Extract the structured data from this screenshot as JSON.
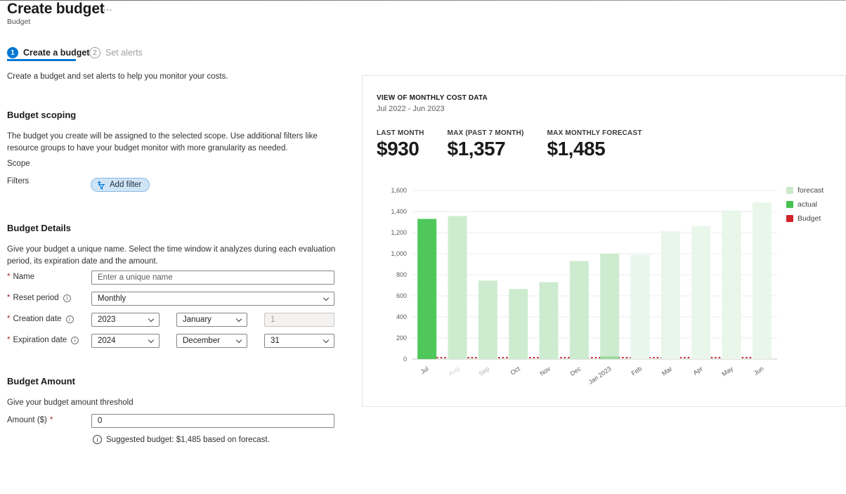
{
  "page": {
    "title": "Create budget",
    "more_label": "…",
    "subtitle": "Budget",
    "description": "Create a budget and set alerts to help you monitor your costs."
  },
  "tabs": [
    {
      "number": "1",
      "label": "Create a budget"
    },
    {
      "number": "2",
      "label": "Set alerts"
    }
  ],
  "scoping": {
    "heading": "Budget scoping",
    "description": "The budget you create will be assigned to the selected scope. Use additional filters like resource groups to have your budget monitor with more granularity as needed.",
    "scope_label": "Scope",
    "filters_label": "Filters",
    "add_filter_label": "Add filter"
  },
  "details": {
    "heading": "Budget Details",
    "description": "Give your budget a unique name. Select the time window it analyzes during each evaluation period, its expiration date and the amount.",
    "name_label": "Name",
    "name_placeholder": "Enter a unique name",
    "reset_period_label": "Reset period",
    "reset_period_value": "Monthly",
    "creation_date_label": "Creation date",
    "creation_year": "2023",
    "creation_month": "January",
    "creation_day": "1",
    "expiration_date_label": "Expiration date",
    "expiration_year": "2024",
    "expiration_month": "December",
    "expiration_day": "31"
  },
  "amount": {
    "heading": "Budget Amount",
    "description": "Give your budget amount threshold",
    "label": "Amount ($)",
    "value": "0",
    "suggestion": "Suggested budget: $1,485 based on forecast."
  },
  "cost_panel": {
    "heading": "VIEW OF MONTHLY COST DATA",
    "date_range": "Jul 2022 - Jun 2023",
    "stats": [
      {
        "label": "LAST MONTH",
        "value": "$930"
      },
      {
        "label": "MAX (PAST 7 MONTH)",
        "value": "$1,357"
      },
      {
        "label": "MAX MONTHLY FORECAST",
        "value": "$1,485"
      }
    ]
  },
  "chart_data": {
    "type": "bar",
    "title": "View of monthly cost data",
    "xlabel": "",
    "ylabel": "",
    "ylim": [
      0,
      1600
    ],
    "ytick_step": 200,
    "grid": "horizontal",
    "legend_position": "top-right",
    "categories": [
      "Jul",
      "Aug",
      "Sep",
      "Oct",
      "Nov",
      "Dec",
      "Jan 2023",
      "Feb",
      "Mar",
      "Apr",
      "May",
      "Jun"
    ],
    "bars": [
      {
        "month": "Jul",
        "value": 1330,
        "kind": "actual"
      },
      {
        "month": "Aug",
        "value": 1357,
        "kind": "forecast",
        "label_color": "#d6d6d6"
      },
      {
        "month": "Sep",
        "value": 745,
        "kind": "forecast",
        "label_color": "#b3b3b3"
      },
      {
        "month": "Oct",
        "value": 665,
        "kind": "forecast"
      },
      {
        "month": "Nov",
        "value": 730,
        "kind": "forecast"
      },
      {
        "month": "Dec",
        "value": 930,
        "kind": "forecast"
      },
      {
        "month": "Jan 2023",
        "value": 1000,
        "kind": "forecast",
        "actual_portion": 25
      },
      {
        "month": "Feb",
        "value": 990,
        "kind": "forecast-light"
      },
      {
        "month": "Mar",
        "value": 1215,
        "kind": "forecast-light"
      },
      {
        "month": "Apr",
        "value": 1260,
        "kind": "forecast-light"
      },
      {
        "month": "May",
        "value": 1410,
        "kind": "forecast-light"
      },
      {
        "month": "Jun",
        "value": 1485,
        "kind": "forecast-light"
      }
    ],
    "budget_line_value": 0,
    "legend": [
      {
        "label": "forecast",
        "color": "#cde9cd"
      },
      {
        "label": "actual",
        "color": "#45c150"
      },
      {
        "label": "Budget",
        "color": "#d2222a"
      }
    ],
    "colors": {
      "actual": "#4fc75a",
      "forecast": "#cdeccf",
      "forecast-light": "#e9f6ea",
      "actual_partial": "#9cd89f",
      "budget_line": "#c2272d",
      "gridline": "#ececec",
      "baseline": "#c9c9c9",
      "tick_text": "#5a5a5a"
    }
  },
  "theme": {
    "accent": "#0078d4",
    "required_red": "#a4262c"
  }
}
